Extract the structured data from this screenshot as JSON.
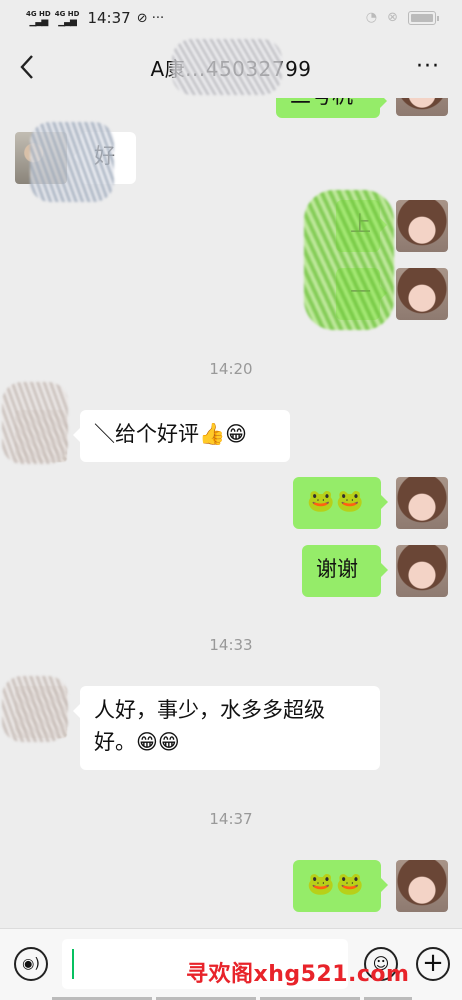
{
  "status_bar": {
    "network_1": "4G HD",
    "network_2": "4G HD",
    "time": "14:37",
    "extra_icons": "⊘ ···"
  },
  "header": {
    "title": "A康...45032799",
    "back_icon": "chevron-left-icon",
    "more_label": "···"
  },
  "messages": [
    {
      "id": "m1",
      "side": "right",
      "text": "二号机"
    },
    {
      "id": "m2",
      "side": "left",
      "text": "好"
    },
    {
      "id": "m3",
      "side": "right",
      "text": "上"
    },
    {
      "id": "m4",
      "side": "right",
      "text": "一"
    },
    {
      "id": "t1",
      "type": "timestamp",
      "text": "14:20"
    },
    {
      "id": "m5",
      "side": "left",
      "text": "＼给个好评👍😁"
    },
    {
      "id": "m6",
      "side": "right",
      "text": "🐸🐸"
    },
    {
      "id": "m7",
      "side": "right",
      "text": "谢谢"
    },
    {
      "id": "t2",
      "type": "timestamp",
      "text": "14:33"
    },
    {
      "id": "m8",
      "side": "left",
      "text": "人好，事少，水多多超级好。😁😁"
    },
    {
      "id": "t3",
      "type": "timestamp",
      "text": "14:37"
    },
    {
      "id": "m9",
      "side": "right",
      "text": "🐸🐸"
    }
  ],
  "input_bar": {
    "voice_icon": "voice-icon",
    "emoji_icon": "emoji-icon",
    "plus_icon": "plus-icon",
    "emoji_label": "☺",
    "plus_label": "+",
    "voice_label": "◉)"
  },
  "watermark": "寻欢阁xhg521.com",
  "colors": {
    "background": "#ededed",
    "bubble_right": "#95ec69",
    "bubble_left": "#ffffff",
    "watermark": "#e8232a"
  }
}
